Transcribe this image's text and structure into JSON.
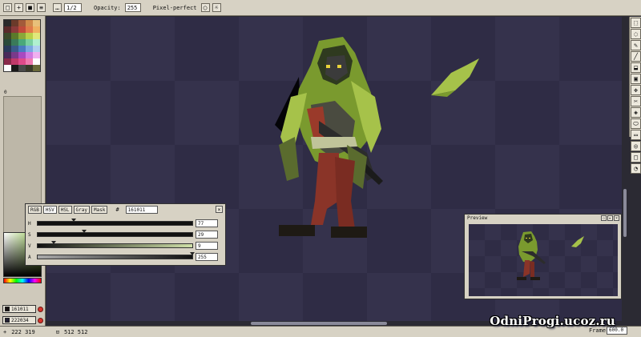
{
  "toolbar": {
    "buttons": [
      "□",
      "+",
      "■",
      "≡"
    ],
    "extra_button": "…",
    "size_value": "1/2",
    "opacity_label": "Opacity:",
    "opacity_value": "255",
    "pixel_perfect_label": "Pixel-perfect"
  },
  "palette": {
    "colors": [
      "#2a2a2a",
      "#6b3a2a",
      "#a35a3a",
      "#d08a4a",
      "#e8c07a",
      "#5a2a2a",
      "#8a3a3a",
      "#c04a3a",
      "#e07a4a",
      "#f0b060",
      "#3a4a2a",
      "#5a7a2a",
      "#8aa83a",
      "#b8d04a",
      "#e0e87a",
      "#2a4a3a",
      "#3a7a5a",
      "#4aa87a",
      "#7ad0a0",
      "#b0f0d0",
      "#2a3a5a",
      "#3a5a8a",
      "#4a7ac0",
      "#7aa8e0",
      "#b0d0f0",
      "#4a2a5a",
      "#7a3a8a",
      "#a84ac0",
      "#d07ae0",
      "#f0b0f0",
      "#8a2a4a",
      "#c03a6a",
      "#e04a8a",
      "#f07ab0",
      "#ffffff",
      "#ffffff",
      "#1a1a1a",
      "#4a4a4a",
      "#3a3a2a",
      "#6a6a3a"
    ],
    "index_label": "0"
  },
  "color_slots": {
    "foreground": {
      "label": "161011",
      "color": "#161011"
    },
    "background": {
      "label": "222034",
      "color": "#222034"
    }
  },
  "color_window": {
    "tabs": [
      "RGB",
      "HSV",
      "HSL",
      "Gray",
      "Mask"
    ],
    "active_tab": "HSV",
    "hex_value": "161011",
    "sliders": [
      {
        "label": "H",
        "value": "77",
        "fraction": 0.22,
        "gradient": "linear-gradient(to right,#111,#111)"
      },
      {
        "label": "S",
        "value": "29",
        "fraction": 0.29,
        "gradient": "linear-gradient(to right,#111,#111)"
      },
      {
        "label": "V",
        "value": "9",
        "fraction": 0.09,
        "gradient": "linear-gradient(to right,#111,#cfe0a8)"
      },
      {
        "label": "A",
        "value": "255",
        "fraction": 1.0,
        "gradient": "linear-gradient(to right,#aaa,#111)"
      }
    ]
  },
  "preview": {
    "title": "Preview",
    "buttons": [
      "▫",
      "▸",
      "×"
    ]
  },
  "status": {
    "cursor": "222 319",
    "size": "512 512",
    "frame_label": "Frame:",
    "frame_value": "600.0"
  },
  "watermark": "OdniProgi.ucoz.ru",
  "tools": [
    "⬚",
    "◌",
    "✎",
    "╱",
    "⬓",
    "▣",
    "✥",
    "✂",
    "◈",
    "⬭",
    "▭",
    "◎",
    "□",
    "◔"
  ]
}
